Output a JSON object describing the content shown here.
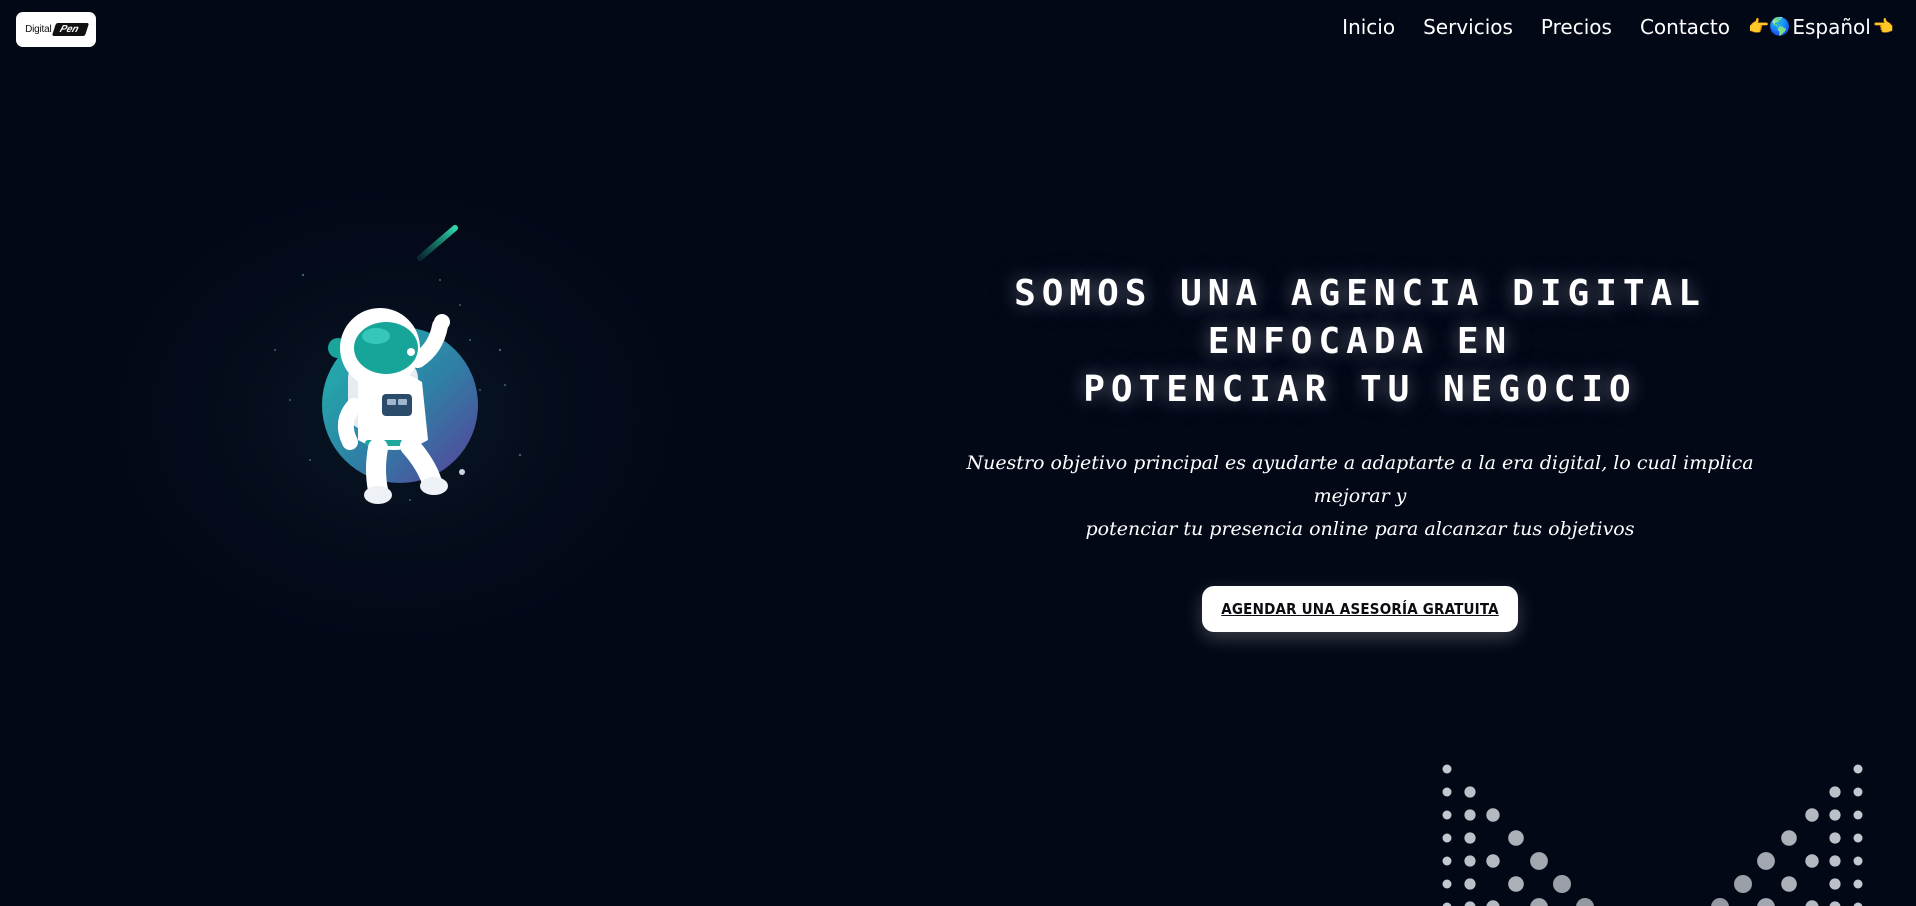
{
  "logo": {
    "left": "Digital",
    "right": "Pen"
  },
  "nav": {
    "items": [
      "Inicio",
      "Servicios",
      "Precios",
      "Contacto"
    ],
    "lang_left_icon": "👉🌎",
    "language": "Español",
    "lang_right_icon": "👈"
  },
  "hero": {
    "title_line1": "SOMOS UNA AGENCIA DIGITAL ENFOCADA EN",
    "title_line2": "POTENCIAR TU NEGOCIO",
    "text_line1": "Nuestro objetivo principal es ayudarte a adaptarte a la era digital, lo cual implica mejorar y",
    "text_line2": "potenciar tu presencia online para alcanzar tus objetivos",
    "cta": "AGENDAR UNA ASESORÍA GRATUITA"
  },
  "colors": {
    "background": "#030817",
    "accent_teal": "#1fb0a8",
    "accent_purple": "#5b3f9a",
    "text": "#ffffff",
    "dots": "#cfd3da"
  },
  "icons": {
    "astronaut": "astronaut-illustration",
    "dots": "dot-pattern"
  }
}
